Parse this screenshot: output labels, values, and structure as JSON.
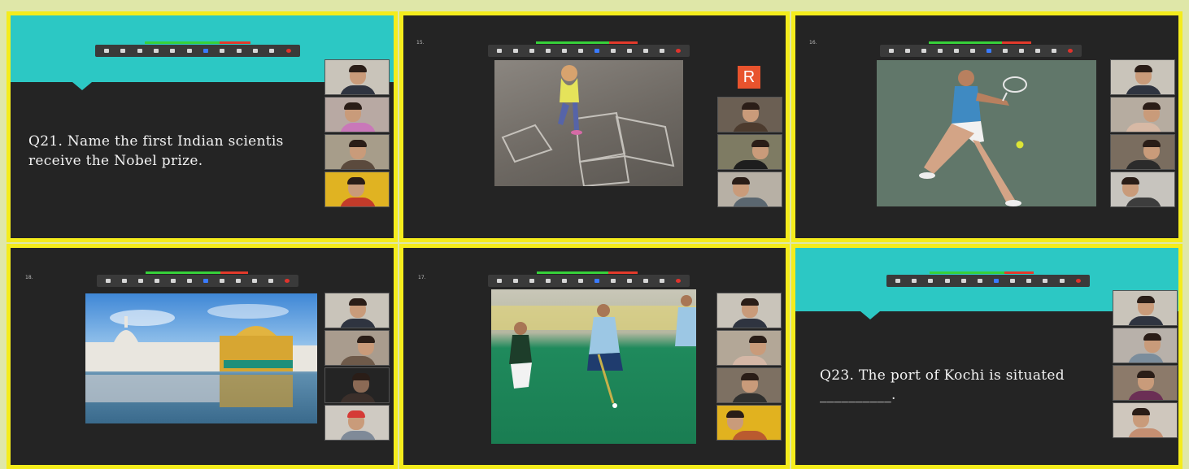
{
  "panels": [
    {
      "question": "Q21. Name the first Indian scientis\nreceive the Nobel prize."
    },
    {
      "slide_number": "15.",
      "badge": "R"
    },
    {
      "slide_number": "16."
    },
    {
      "slide_number": "18."
    },
    {
      "slide_number": "17."
    },
    {
      "question": "Q23. The port of Kochi is situated\n__________."
    }
  ],
  "colors": {
    "frame_border": "#f4ec1c",
    "panel_bg": "#242424",
    "teal": "#2cc8c4",
    "recording_green": "#37d13a",
    "recording_red": "#e33a2b"
  },
  "toolbar_icons": [
    "mute-icon",
    "video-icon",
    "security-icon",
    "participants-icon",
    "chat-icon",
    "share-screen-icon",
    "record-icon",
    "reactions-icon",
    "apps-icon",
    "whiteboard-icon",
    "more-icon",
    "end-icon"
  ]
}
